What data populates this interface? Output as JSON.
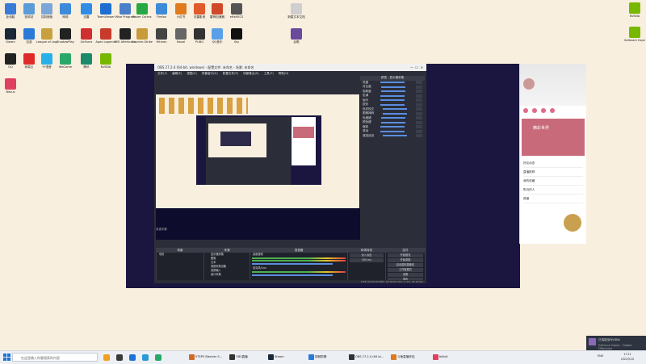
{
  "colors": {
    "desktop_bg": "#f8efdf",
    "obs_bg": "#2b2e38",
    "accent": "#5a8de0",
    "taskbar": "#eceff4"
  },
  "desktop_icons": [
    {
      "name": "computer-icon",
      "label": "此电脑",
      "color": "#3b7bd8"
    },
    {
      "name": "recycle-icon",
      "label": "回收站",
      "color": "#5a9bd8"
    },
    {
      "name": "app-icon",
      "label": "控制面板",
      "color": "#7aa6d8"
    },
    {
      "name": "app-icon",
      "label": "网络",
      "color": "#3e8ad8"
    },
    {
      "name": "app-icon",
      "label": "迅雷",
      "color": "#2f8de8"
    },
    {
      "name": "app-icon",
      "label": "TeamViewer",
      "color": "#1f6fd0"
    },
    {
      "name": "app-icon",
      "label": "Wise Program",
      "color": "#4a7ec8"
    },
    {
      "name": "app-icon",
      "label": "Razer Cortex",
      "color": "#28a745"
    },
    {
      "name": "app-icon",
      "label": "Firefox",
      "color": "#3d8bd8"
    },
    {
      "name": "app-icon",
      "label": "小红书",
      "color": "#e07a1f"
    },
    {
      "name": "app-icon",
      "label": "迅雷影音",
      "color": "#e05a2a"
    },
    {
      "name": "app-icon",
      "label": "雷神加速器",
      "color": "#d04a2a"
    },
    {
      "name": "app-icon",
      "label": "eftsHSCS",
      "color": "#555555"
    },
    {
      "name": "app-icon",
      "label": "新建文本文档",
      "color": "#cfcfcf"
    },
    {
      "name": "steam-icon",
      "label": "Steam",
      "color": "#1b2838"
    },
    {
      "name": "app-icon",
      "label": "迅游",
      "color": "#2a7ad8"
    },
    {
      "name": "app-icon",
      "label": "League of Legends",
      "color": "#c8a040"
    },
    {
      "name": "app-icon",
      "label": "ShadowPlay",
      "color": "#222222"
    },
    {
      "name": "app-icon",
      "label": "GeForce",
      "color": "#d03030"
    },
    {
      "name": "app-icon",
      "label": "Apex Legends",
      "color": "#c83a2a"
    },
    {
      "name": "app-icon",
      "label": "MSI Afterburner",
      "color": "#222222"
    },
    {
      "name": "app-icon",
      "label": "Counter-Strike",
      "color": "#c89a3a"
    },
    {
      "name": "app-icon",
      "label": "Hitman",
      "color": "#444444"
    },
    {
      "name": "app-icon",
      "label": "Naval",
      "color": "#666666"
    },
    {
      "name": "app-icon",
      "label": "PUBG",
      "color": "#333333"
    },
    {
      "name": "app-icon",
      "label": "QQ音乐",
      "color": "#5aa0e8"
    },
    {
      "name": "app-icon",
      "label": "Sky",
      "color": "#111111"
    },
    {
      "name": "app-icon",
      "label": "谷歌",
      "color": "#6a4a9a"
    },
    {
      "name": "qq-icon",
      "label": "QQ",
      "color": "#222222"
    },
    {
      "name": "app-icon",
      "label": "网易云",
      "color": "#e02a2a"
    },
    {
      "name": "app-icon",
      "label": "YY语音",
      "color": "#2ab0e8"
    },
    {
      "name": "app-icon",
      "label": "WeGame",
      "color": "#2aa86a"
    },
    {
      "name": "app-icon",
      "label": "腾讯",
      "color": "#1a8a6a"
    },
    {
      "name": "app-icon",
      "label": "NVIDIA",
      "color": "#76b900"
    },
    {
      "name": "app-icon",
      "label": "Nexus",
      "color": "#e04060"
    },
    {
      "name": "app-icon",
      "label": "GeForce Experience",
      "color": "#76b900"
    },
    {
      "name": "app-icon",
      "label": "Nvidia Experience",
      "color": "#76b900"
    }
  ],
  "obs": {
    "title": "OBS 27.2.4 (64-bit, windows) - 配置文件: 未命名 - 场景: 未命名",
    "menu": [
      "文件(F)",
      "编辑(E)",
      "视图(V)",
      "停靠窗口(D)",
      "配置文件(P)",
      "场景集合(S)",
      "工具(T)",
      "帮助(H)"
    ],
    "right_panel_title": "滤镜 - 显示器采集",
    "right_rows": [
      "亮度",
      "对比度",
      "饱和度",
      "色调",
      "伽马",
      "锐化",
      "色彩校正",
      "图像掩码",
      "色度键",
      "颜色键",
      "缩放",
      "滚动",
      "渲染延迟"
    ],
    "docks": {
      "scenes": "场景",
      "sources": "来源",
      "mixer": "混音器",
      "transitions": "转场特效",
      "controls": "控件"
    },
    "scene_name": "场景",
    "sources": [
      "显示器采集",
      "图像",
      "文本",
      "视频采集设备",
      "音频输入",
      "窗口采集"
    ],
    "mixer_tracks": [
      "桌面音频",
      "麦克风/Aux"
    ],
    "transition": "淡入淡出",
    "duration": "300 ms",
    "controls": [
      "开始推流",
      "开始录制",
      "启动虚拟摄像机",
      "工作室模式",
      "设置",
      "退出"
    ],
    "status": "LIVE: 00:00:00  REC: 00:00:00  CPU: 2.1%, 60.00 fps",
    "preview_label": "未选中源"
  },
  "qq": {
    "banner": "精彩世界",
    "items": [
      "好友动态",
      "直播推荐",
      "我的收藏",
      "附近的人",
      "频道"
    ]
  },
  "taskbar": {
    "search_placeholder": "在这里输入你要搜索的内容",
    "apps": [
      {
        "label": "STEPS Blender S...",
        "color": "#d06a2a"
      },
      {
        "label": "OBS直播",
        "color": "#333333"
      },
      {
        "label": "Steam",
        "color": "#1b2838"
      },
      {
        "label": "视频剪辑",
        "color": "#2a7ad8"
      },
      {
        "label": "OBS 27.2.4 (64 bi...",
        "color": "#333333"
      },
      {
        "label": "斗鱼直播伴侣",
        "color": "#e07a1f"
      },
      {
        "label": "bilibili",
        "color": "#e04060"
      }
    ],
    "time": "17:21",
    "date": "2022/5/10",
    "lang": "ENG"
  },
  "notification": {
    "title": "已连接至NVIDIA",
    "text": "GeForce Game · Global Offensive"
  },
  "steam_side": {
    "label": "Software Experience"
  }
}
